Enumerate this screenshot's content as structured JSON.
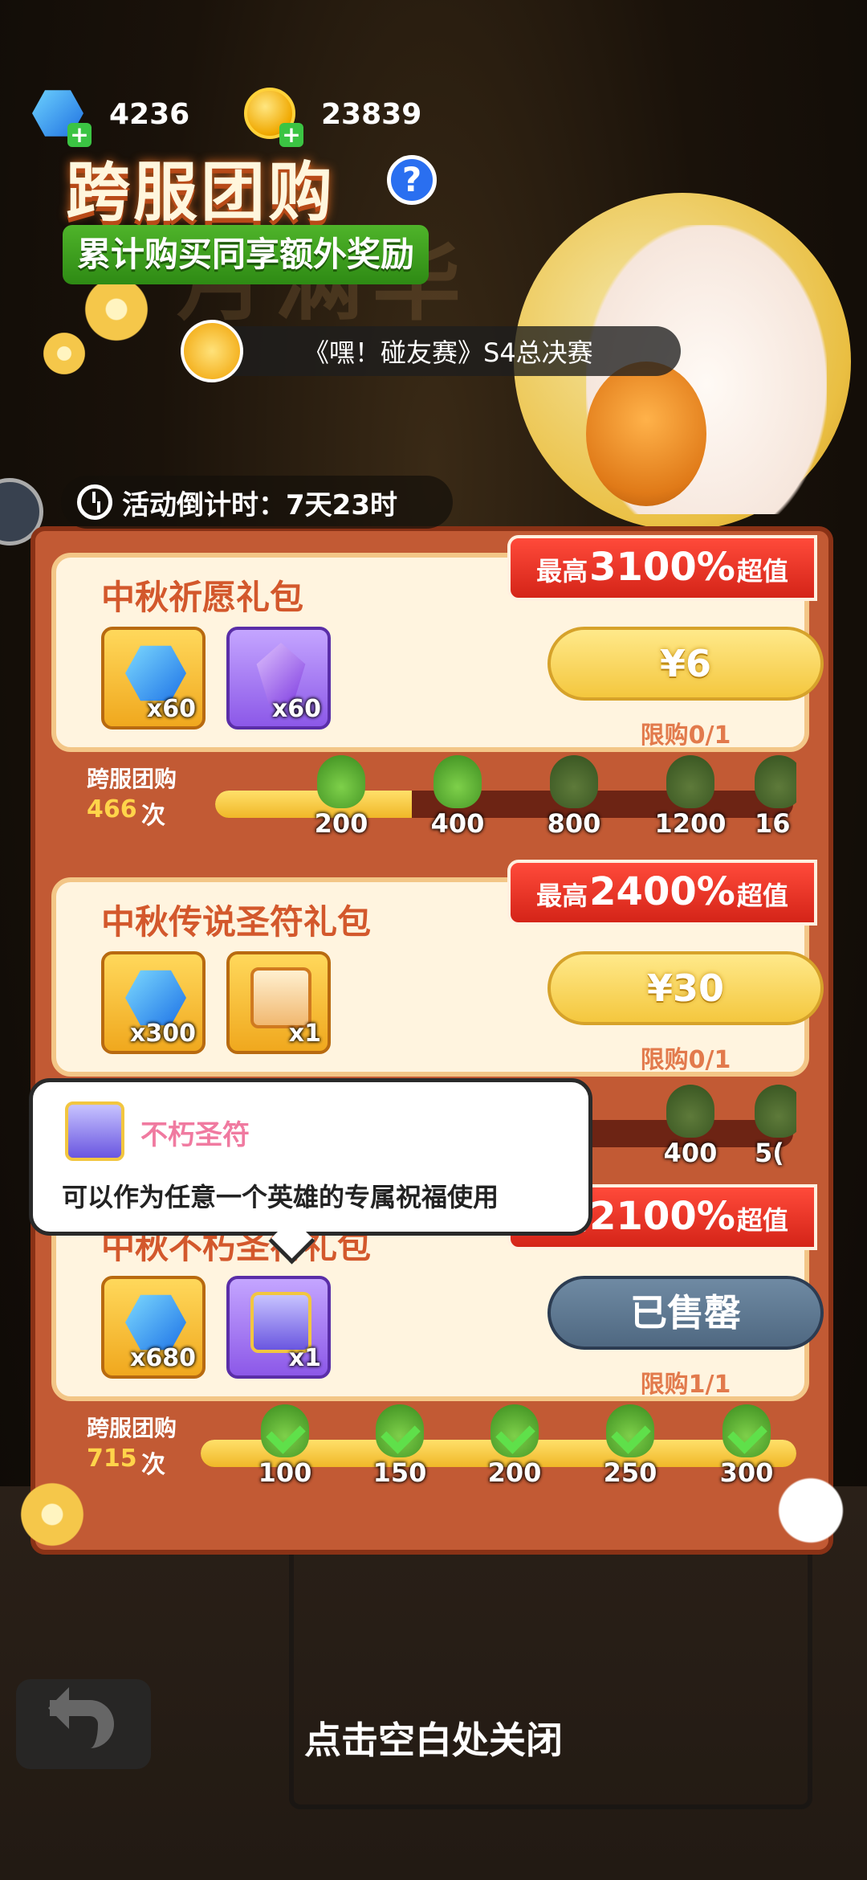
{
  "currency": [
    {
      "icon": "blue-gem-icon",
      "amount": "4236"
    },
    {
      "icon": "gold-coin-icon",
      "amount": "23839"
    }
  ],
  "header": {
    "title": "跨服团购",
    "subtitle": "累计购买同享额外奖励",
    "countdown_label": "活动倒计时：7天23时",
    "marquee": "《嘿！碰友赛》S4总决赛"
  },
  "packs": [
    {
      "title": "中秋祈愿礼包",
      "ribbon_prefix": "最高",
      "ribbon_value": "3100%",
      "ribbon_suffix": "超值",
      "items": [
        {
          "icon": "blue-gem-icon",
          "qty": "x60"
        },
        {
          "icon": "purple-crystal-icon",
          "qty": "x60"
        }
      ],
      "price": "¥6",
      "limit": "限购0/1",
      "progress_label": "跨服团购",
      "progress_count": "466",
      "progress_unit": "次",
      "milestones": [
        "200",
        "400",
        "800",
        "1200",
        "16"
      ]
    },
    {
      "title": "中秋传说圣符礼包",
      "ribbon_prefix": "最高",
      "ribbon_value": "2400%",
      "ribbon_suffix": "超值",
      "items": [
        {
          "icon": "blue-gem-icon",
          "qty": "x300"
        },
        {
          "icon": "legend-scroll-icon",
          "qty": "x1"
        }
      ],
      "price": "¥30",
      "limit": "限购0/1",
      "milestones": [
        "400",
        "5("
      ]
    },
    {
      "title": "中秋不朽圣符礼包",
      "ribbon_prefix": "最高",
      "ribbon_value": "2100%",
      "ribbon_suffix": "超值",
      "items": [
        {
          "icon": "blue-gem-icon",
          "qty": "x680"
        },
        {
          "icon": "immortal-scroll-icon",
          "qty": "x1"
        }
      ],
      "price": "已售罄",
      "limit": "限购1/1",
      "progress_label": "跨服团购",
      "progress_count": "715",
      "progress_unit": "次",
      "milestones": [
        "100",
        "150",
        "200",
        "250",
        "300"
      ]
    }
  ],
  "tooltip": {
    "name": "不朽圣符",
    "description": "可以作为任意一个英雄的专属祝福使用"
  },
  "footer": {
    "close_hint": "点击空白处关闭"
  }
}
